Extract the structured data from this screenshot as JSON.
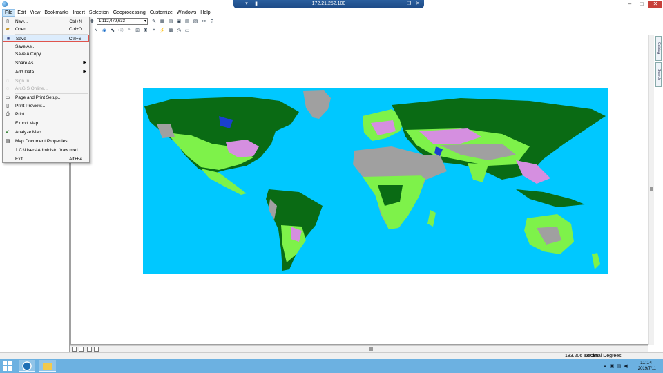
{
  "remote_session": {
    "host": "172.21.252.100"
  },
  "menubar": {
    "items": [
      "File",
      "Edit",
      "View",
      "Bookmarks",
      "Insert",
      "Selection",
      "Geoprocessing",
      "Customize",
      "Windows",
      "Help"
    ]
  },
  "toolbar": {
    "scale": "1:112,479,633"
  },
  "file_menu": {
    "items": [
      {
        "label": "New...",
        "shortcut": "Ctrl+N",
        "icon": "new-document-icon"
      },
      {
        "label": "Open...",
        "shortcut": "Ctrl+O",
        "icon": "open-folder-icon"
      },
      {
        "label": "Save",
        "shortcut": "Ctrl+S",
        "icon": "save-icon"
      },
      {
        "label": "Save As...",
        "shortcut": ""
      },
      {
        "label": "Save A Copy...",
        "shortcut": ""
      },
      {
        "label": "Share As",
        "submenu": true
      },
      {
        "label": "Add Data",
        "submenu": true
      },
      {
        "label": "Sign In...",
        "disabled": true
      },
      {
        "label": "ArcGIS Online...",
        "disabled": true
      },
      {
        "label": "Page and Print Setup...",
        "icon": "page-setup-icon"
      },
      {
        "label": "Print Preview...",
        "icon": "print-preview-icon"
      },
      {
        "label": "Print...",
        "icon": "print-icon"
      },
      {
        "label": "Export Map..."
      },
      {
        "label": "Analyze Map...",
        "icon": "analyze-icon"
      },
      {
        "label": "Map Document Properties...",
        "icon": "properties-icon"
      },
      {
        "label": "1 C:\\Users\\Administr...\\raw.mxd"
      },
      {
        "label": "Exit",
        "shortcut": "Alt+F4"
      }
    ]
  },
  "side_tabs": [
    "Catalog",
    "Search"
  ],
  "statusbar": {
    "coords": "183.206  78.088",
    "units": "Decimal Degrees"
  },
  "taskbar": {
    "time": "11:14",
    "date": "2019/7/11"
  },
  "colors": {
    "ocean": "#00c8ff",
    "dense_forest": "#0a6b14",
    "grassland": "#7ef24a",
    "cropland": "#d58fe0",
    "barren": "#a0a0a0",
    "water": "#1a3fd0"
  }
}
